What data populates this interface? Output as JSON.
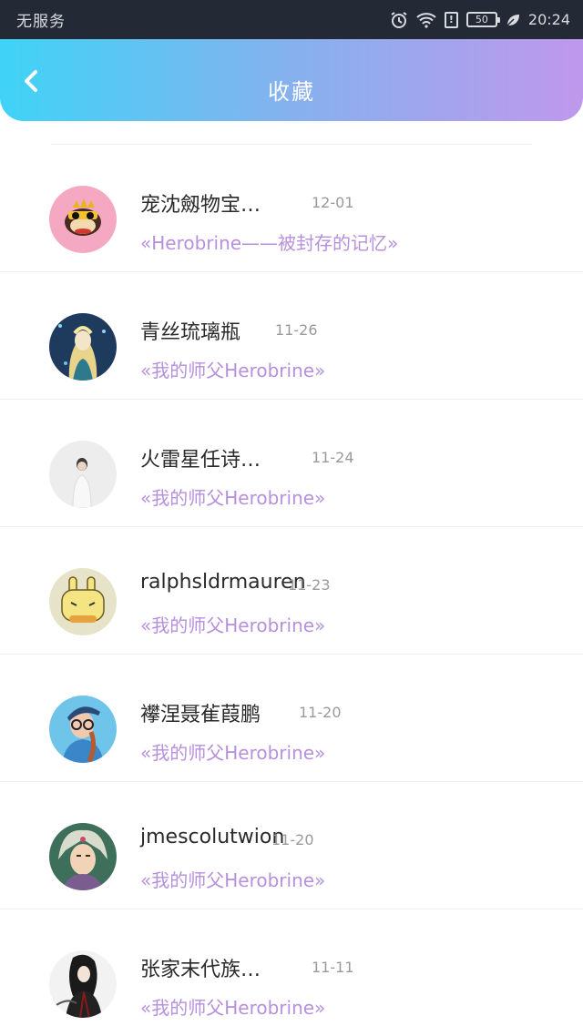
{
  "status_bar": {
    "carrier": "无服务",
    "battery": "50",
    "time": "20:24",
    "icons": [
      "alarm-icon",
      "wifi-icon",
      "sim-alert-icon",
      "battery-icon",
      "leaf-icon"
    ]
  },
  "header": {
    "title": "收藏",
    "back_icon": "chevron-left-icon",
    "gradient": [
      "#3fd3f7",
      "#86b1ee",
      "#bf98ec"
    ]
  },
  "items": [
    {
      "name": "宠沈劔物宝…",
      "date": "12-01",
      "work": "«Herobrine——被封存的记忆»",
      "avatar": "monkey-cartoon-avatar"
    },
    {
      "name": "青丝琉璃瓶",
      "date": "11-26",
      "work": "«我的师父Herobrine»",
      "avatar": "anime-girl-avatar"
    },
    {
      "name": "火雷星任诗…",
      "date": "11-24",
      "work": "«我的师父Herobrine»",
      "avatar": "person-white-avatar"
    },
    {
      "name": "ralphsldrmauren",
      "date": "11-23",
      "work": "«我的师父Herobrine»",
      "avatar": "bunny-cartoon-avatar"
    },
    {
      "name": "襻涅聂雈葭鹏",
      "date": "11-20",
      "work": "«我的师父Herobrine»",
      "avatar": "girl-glasses-avatar"
    },
    {
      "name": "jmescolutwion",
      "date": "11-20",
      "work": "«我的师父Herobrine»",
      "avatar": "anime-boy-avatar"
    },
    {
      "name": "张家末代族…",
      "date": "11-11",
      "work": "«我的师父Herobrine»",
      "avatar": "dark-warrior-avatar"
    }
  ],
  "colors": {
    "status_bar_bg": "#232a36",
    "work_title": "#b690dd",
    "date": "#9a9a9a",
    "name": "#2a2a2a"
  }
}
